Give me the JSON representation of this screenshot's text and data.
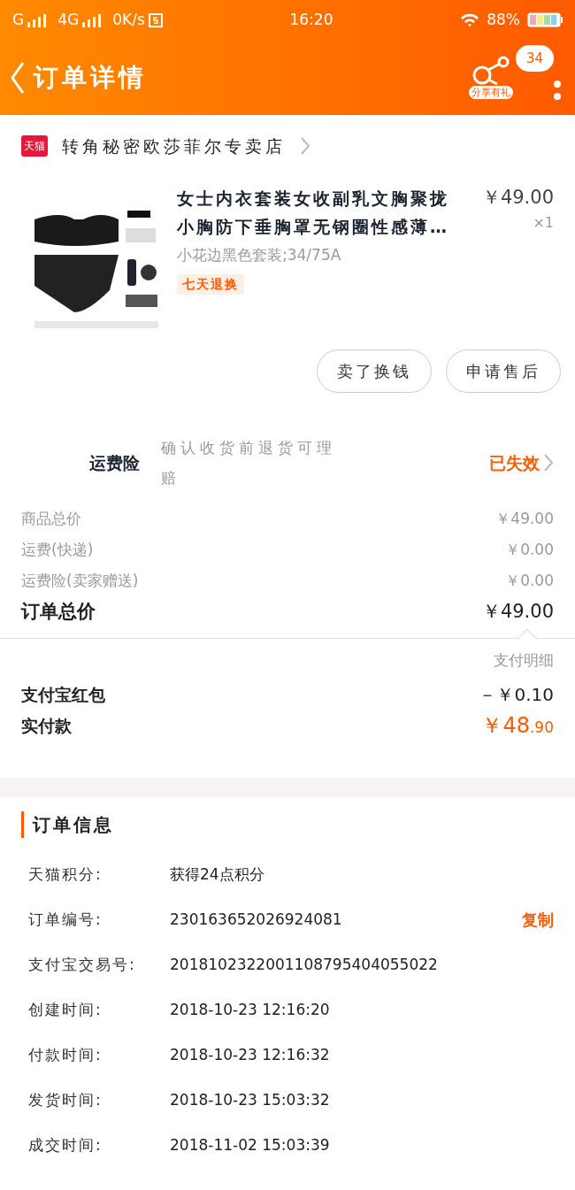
{
  "status_bar": {
    "signal_1": "G",
    "signal_2": "4G",
    "speed": "0K/s",
    "time": "16:20",
    "battery": "88%"
  },
  "header": {
    "title": "订单详情",
    "share_label": "分享有礼",
    "badge": "34"
  },
  "store": {
    "badge": "天猫",
    "name": "转角秘密欧莎菲尔专卖店"
  },
  "product": {
    "kind": "picture",
    "title_lines": [
      "女士内衣套装女收副乳文胸聚拢",
      "小胸防下垂胸罩无钢圈性感薄…"
    ],
    "price": "￥49.00",
    "quantity": "×1",
    "sku": "小花边黑色套装;34/75A",
    "tag": "七天退换"
  },
  "actions": [
    "卖了换钱",
    "申请售后"
  ],
  "insurance": {
    "label": "运费险",
    "description": "确认收货前退货可理赔",
    "status": "已失效"
  },
  "summary": [
    {
      "kind": "sub",
      "label": "商品总价",
      "amount": "￥49.00"
    },
    {
      "kind": "sub",
      "label": "运费(快递)",
      "amount": "￥0.00"
    },
    {
      "kind": "sub",
      "label": "运费险(卖家赠送)",
      "amount": "￥0.00"
    },
    {
      "kind": "total",
      "label": "订单总价",
      "amount": "￥49.00"
    }
  ],
  "payment": {
    "detail_link": "支付明细",
    "rows": [
      {
        "label": "支付宝红包",
        "amount": "－￥0.10"
      }
    ],
    "paid": {
      "label": "实付款",
      "amount_main": "￥48",
      "amount_cents": ".90"
    }
  },
  "order_info": {
    "title": "订单信息",
    "rows": [
      {
        "label": "天猫积分:",
        "value": "获得24点积分"
      },
      {
        "label": "订单编号:",
        "value": "230163652026924081",
        "action": "复制"
      },
      {
        "label": "支付宝交易号:",
        "value": "2018102322001108795404055022"
      },
      {
        "label": "创建时间:",
        "value": "2018-10-23 12:16:20"
      },
      {
        "label": "付款时间:",
        "value": "2018-10-23 12:16:32"
      },
      {
        "label": "发货时间:",
        "value": "2018-10-23 15:03:32"
      },
      {
        "label": "成交时间:",
        "value": "2018-11-02 15:03:39"
      }
    ]
  }
}
